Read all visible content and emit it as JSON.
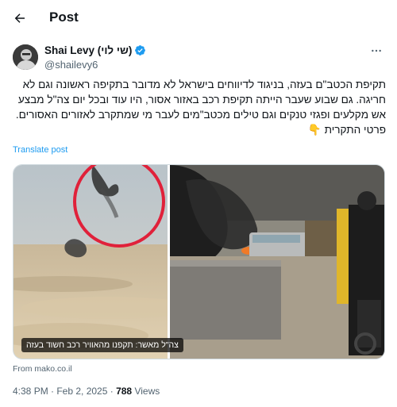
{
  "header": {
    "title": "Post"
  },
  "author": {
    "name": "Shai Levy (שי לוי)",
    "handle": "@shailevy6"
  },
  "tweet": {
    "text": "תקיפת הכטב\"ם בעזה, בניגוד לדיווחים בישראל לא מדובר בתקיפה ראשונה וגם לא חריגה. גם שבוע שעבר הייתה תקיפת רכב באזור אסור, היו עוד ובכל יום צה\"ל מבצע אש מקלעים ופגזי טנקים וגם טילים מכטב\"מים לעבר מי שמתקרב לאזורים האסורים. פרטי התקרית 👇",
    "translate_label": "Translate post"
  },
  "media": {
    "caption": "צה\"ל מאשר: תקפנו מהאוויר רכב חשוד בעזה"
  },
  "source": "From mako.co.il",
  "meta": {
    "timestamp": "4:38 PM · Feb 2, 2025 · ",
    "views_count": "788",
    "views_label": " Views"
  },
  "colors": {
    "accent": "#1d9bf0",
    "circle": "#e0213a",
    "text": "#0f1419",
    "muted": "#536471"
  },
  "icons": [
    "back-arrow-icon",
    "verified-badge-icon",
    "more-options-icon"
  ]
}
